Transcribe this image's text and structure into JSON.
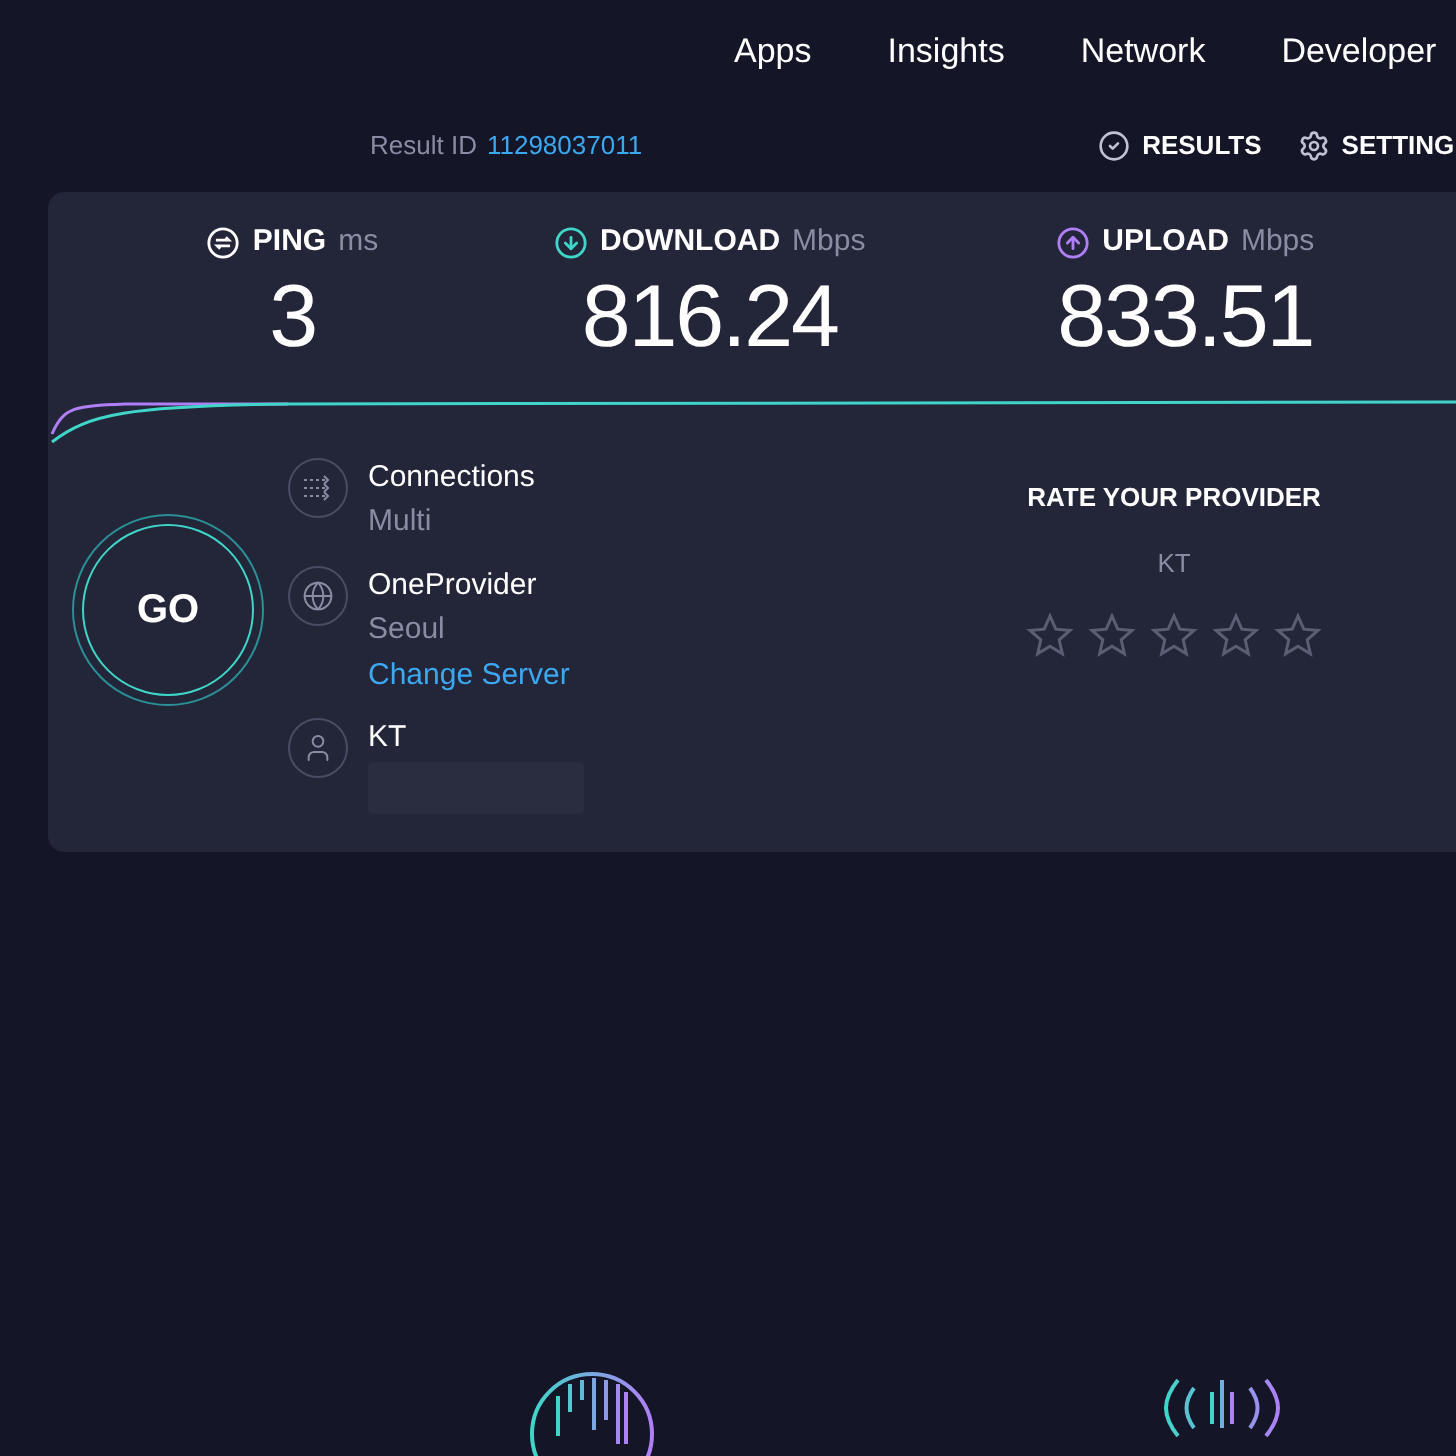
{
  "nav": {
    "items": [
      "Apps",
      "Insights",
      "Network",
      "Developer"
    ]
  },
  "result": {
    "label": "Result ID",
    "id": "11298037011"
  },
  "actions": [
    {
      "kind": "results",
      "label": "RESULTS"
    },
    {
      "kind": "settings",
      "label": "SETTING"
    }
  ],
  "metrics": [
    {
      "kind": "ping",
      "label": "PING",
      "unit": "ms",
      "value": "3"
    },
    {
      "kind": "download",
      "label": "DOWNLOAD",
      "unit": "Mbps",
      "value": "816.24"
    },
    {
      "kind": "upload",
      "label": "UPLOAD",
      "unit": "Mbps",
      "value": "833.51"
    }
  ],
  "go_button": "GO",
  "server_info": [
    {
      "kind": "connections",
      "title": "Connections",
      "subtitle": "Multi"
    },
    {
      "kind": "server",
      "title": "OneProvider",
      "subtitle": "Seoul",
      "link": "Change Server"
    },
    {
      "kind": "isp",
      "title": "KT"
    }
  ],
  "rating": {
    "title": "RATE YOUR PROVIDER",
    "provider": "KT",
    "stars": 0
  }
}
